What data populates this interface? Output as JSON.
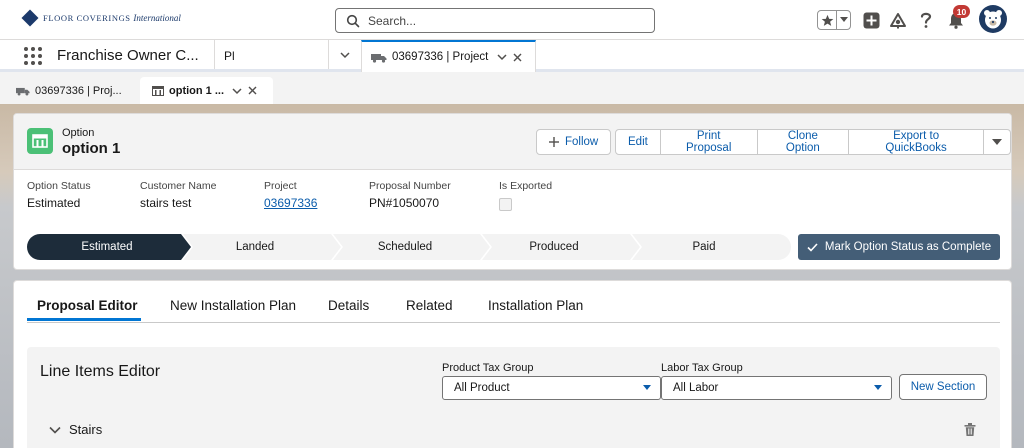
{
  "header": {
    "logo_text": "FLOOR COVERINGS",
    "logo_script": "International",
    "search_placeholder": "Search...",
    "notification_count": "10"
  },
  "app_nav": {
    "app_name": "Franchise Owner C...",
    "nav_input": "Pl",
    "tab_label": "03697336 | Project"
  },
  "subtabs": [
    {
      "label": "03697336 | Proj..."
    },
    {
      "label": "option 1 ..."
    }
  ],
  "record": {
    "type": "Option",
    "title": "option 1",
    "actions": {
      "follow": "Follow",
      "edit": "Edit",
      "print": "Print Proposal",
      "clone": "Clone Option",
      "export": "Export to QuickBooks"
    },
    "fields": [
      {
        "label": "Option Status",
        "value": "Estimated"
      },
      {
        "label": "Customer Name",
        "value": "stairs test"
      },
      {
        "label": "Project",
        "value": "03697336"
      },
      {
        "label": "Proposal Number",
        "value": "PN#1050070"
      },
      {
        "label": "Is Exported",
        "value": false
      }
    ],
    "path": {
      "stages": [
        "Estimated",
        "Landed",
        "Scheduled",
        "Produced",
        "Paid"
      ],
      "current": "Estimated"
    },
    "mark_button": "Mark Option Status as Complete"
  },
  "tabs": [
    {
      "label": "Proposal Editor"
    },
    {
      "label": "New Installation Plan"
    },
    {
      "label": "Details"
    },
    {
      "label": "Related"
    },
    {
      "label": "Installation Plan"
    }
  ],
  "editor": {
    "title": "Line Items Editor",
    "product_tax_label": "Product Tax Group",
    "product_tax_value": "All Product",
    "labor_tax_label": "Labor Tax Group",
    "labor_tax_value": "All Labor",
    "new_section": "New Section",
    "section_name": "Stairs"
  },
  "colors": {
    "brand_blue": "#0176d3",
    "path_active": "#1d2c3a",
    "mark_button": "#445e77",
    "record_icon": "#4bc076",
    "link": "#0b5cab"
  }
}
